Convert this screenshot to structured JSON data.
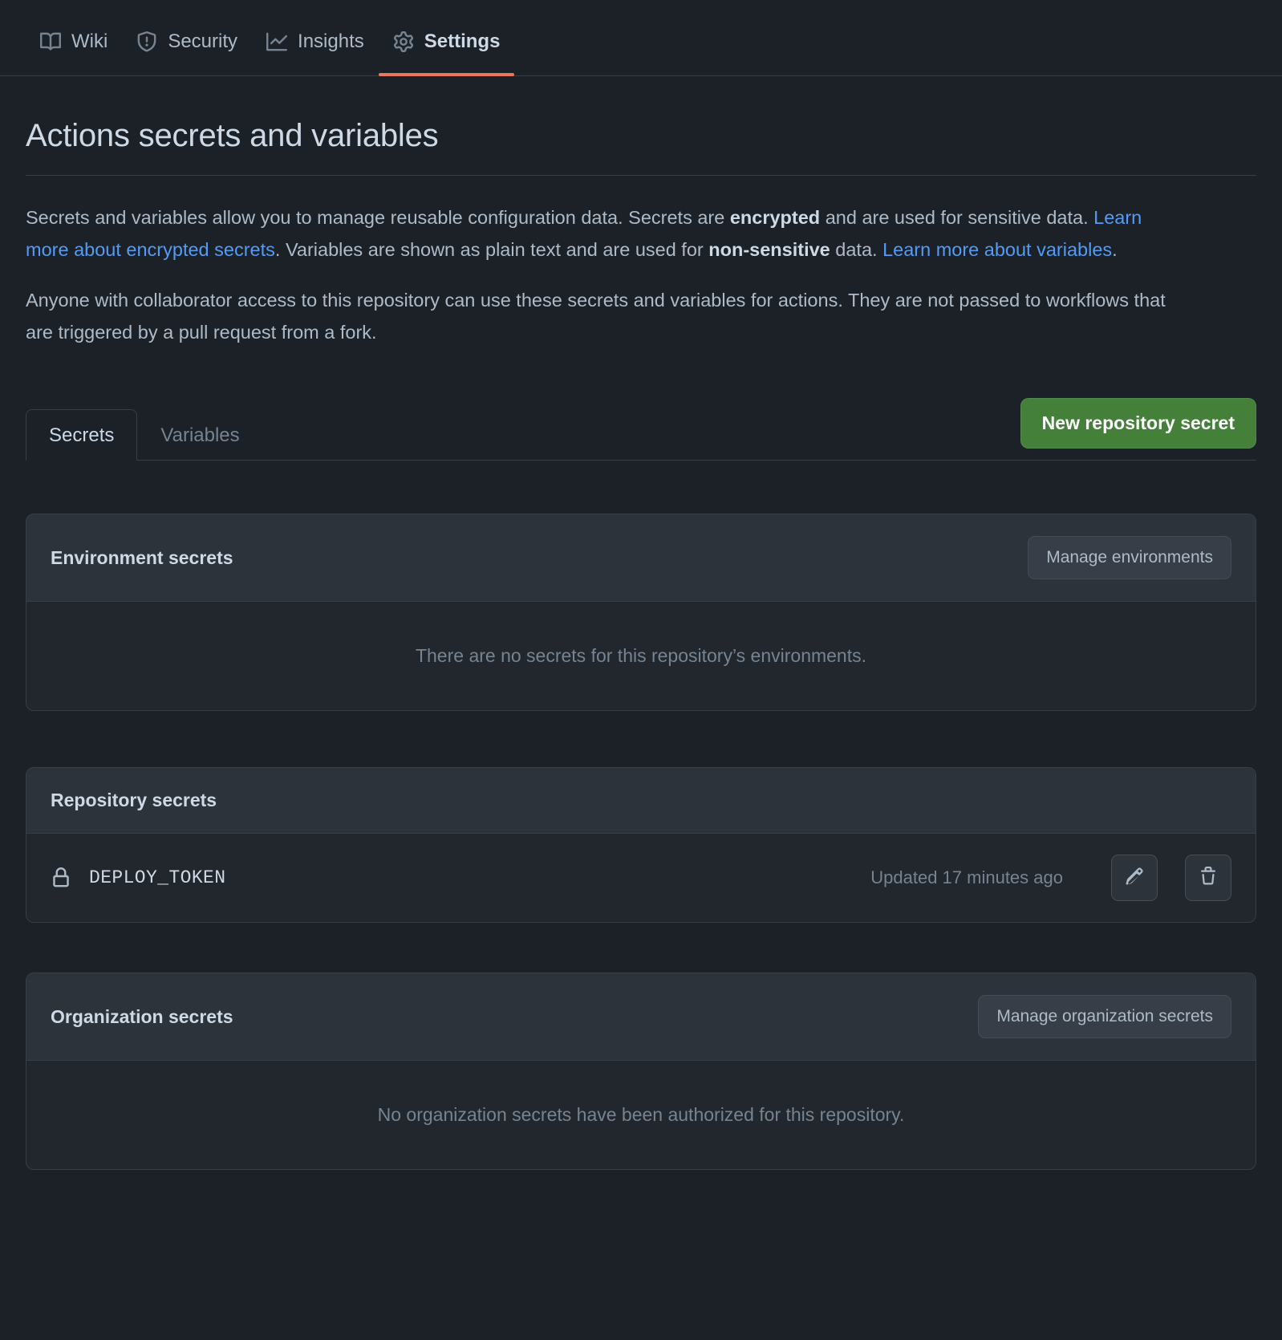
{
  "nav": {
    "items": [
      {
        "label": "Wiki",
        "icon": "book-icon",
        "active": false
      },
      {
        "label": "Security",
        "icon": "shield-alert-icon",
        "active": false
      },
      {
        "label": "Insights",
        "icon": "graph-icon",
        "active": false
      },
      {
        "label": "Settings",
        "icon": "gear-icon",
        "active": true
      }
    ]
  },
  "page": {
    "title": "Actions secrets and variables",
    "paragraph1": {
      "part1": "Secrets and variables allow you to manage reusable configuration data. Secrets are ",
      "bold1": "encrypted",
      "part2": " and are used for sensitive data. ",
      "link1": "Learn more about encrypted secrets",
      "part3": ". Variables are shown as plain text and are used for ",
      "bold2": "non-sensitive",
      "part4": " data. ",
      "link2": "Learn more about variables",
      "part5": "."
    },
    "paragraph2": "Anyone with collaborator access to this repository can use these secrets and variables for actions. They are not passed to workflows that are triggered by a pull request from a fork."
  },
  "tabs": [
    {
      "label": "Secrets",
      "active": true
    },
    {
      "label": "Variables",
      "active": false
    }
  ],
  "actions": {
    "new_secret_label": "New repository secret"
  },
  "panels": {
    "environment": {
      "title": "Environment secrets",
      "button_label": "Manage environments",
      "empty_message": "There are no secrets for this repository’s environments."
    },
    "repository": {
      "title": "Repository secrets",
      "secrets": [
        {
          "name": "DEPLOY_TOKEN",
          "updated": "Updated 17 minutes ago"
        }
      ]
    },
    "organization": {
      "title": "Organization secrets",
      "button_label": "Manage organization secrets",
      "empty_message": "No organization secrets have been authorized for this repository."
    }
  },
  "colors": {
    "background": "#1c2128",
    "panel": "#22272e",
    "panel_header": "#2d333b",
    "border": "#373e47",
    "accent_tab": "#ec775c",
    "link": "#539bf5",
    "primary_button": "#44803a",
    "text": "#adbac7",
    "text_bright": "#cdd9e5",
    "text_muted": "#768390"
  }
}
